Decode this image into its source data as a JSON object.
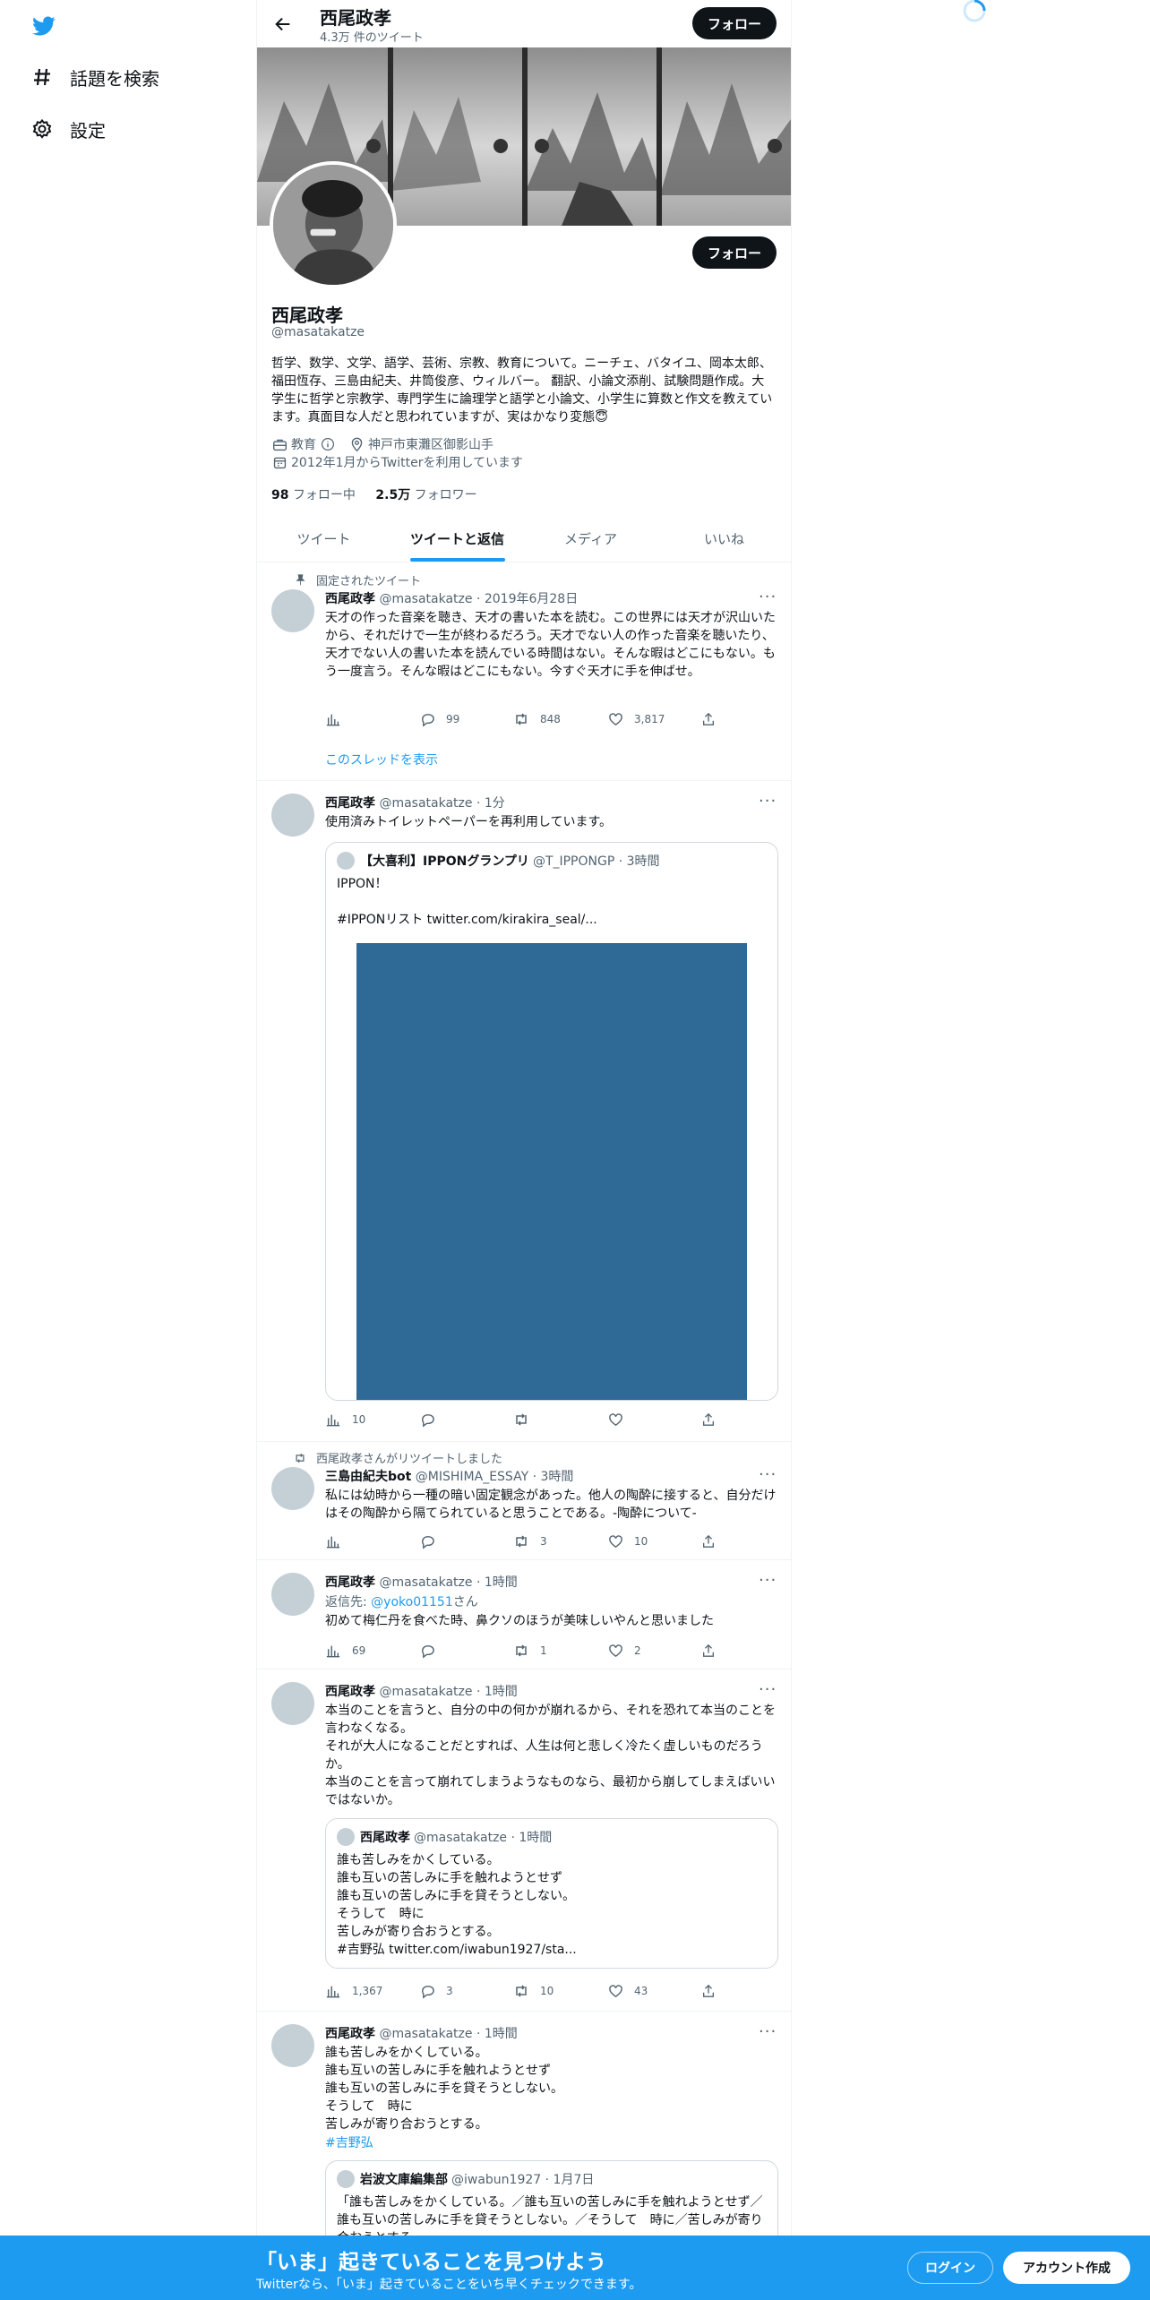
{
  "nav": {
    "items": [
      {
        "label": "話題を検索",
        "icon": "hash-icon"
      },
      {
        "label": "設定",
        "icon": "gear-icon"
      }
    ]
  },
  "header": {
    "name": "西尾政孝",
    "tweet_count": "4.3万 件のツイート",
    "follow_label": "フォロー"
  },
  "profile": {
    "name": "西尾政孝",
    "handle": "@masatakatze",
    "follow_label": "フォロー",
    "bio": "哲学、数学、文学、語学、芸術、宗教、教育について。ニーチェ、バタイユ、岡本太郎、福田恆存、三島由紀夫、井筒俊彦、ウィルバー。 翻訳、小論文添削、試験問題作成。大学生に哲学と宗教学、専門学生に論理学と語学と小論文、小学生に算数と作文を教えています。真面目な人だと思われていますが、実はかなり変態😇",
    "category": "教育",
    "location": "神戸市東灘区御影山手",
    "joined": "2012年1月からTwitterを利用しています",
    "following_count": "98",
    "following_label": "フォロー中",
    "followers_count": "2.5万",
    "followers_label": "フォロワー"
  },
  "tabs": [
    "ツイート",
    "ツイートと返信",
    "メディア",
    "いいね"
  ],
  "active_tab": 1,
  "tweets": [
    {
      "social": "固定されたツイート",
      "name": "西尾政孝",
      "meta": "@masatakatze · 2019年6月28日",
      "text": "天才の作った音楽を聴き、天才の書いた本を読む。この世界には天才が沢山いたから、それだけで一生が終わるだろう。天才でない人の作った音楽を聴いたり、天才でない人の書いた本を読んでいる時間はない。そんな暇はどこにもない。もう一度言う。そんな暇はどこにもない。今すぐ天才に手を伸ばせ。",
      "views": "",
      "replies": "99",
      "retweets": "848",
      "likes": "3,817",
      "thread_link": "このスレッドを表示"
    },
    {
      "name": "西尾政孝",
      "meta": "@masatakatze · 1分",
      "text": "使用済みトイレットペーパーを再利用しています。",
      "quote": {
        "name": "【大喜利】IPPONグランプリ",
        "meta": "@T_IPPONGP · 3時間",
        "text": "IPPON！\n\n#IPPONリスト  twitter.com/kirakira_seal/..."
      },
      "views": "10",
      "replies": "",
      "retweets": "",
      "likes": ""
    },
    {
      "social": "西尾政孝さんがリツイートしました",
      "name": "三島由紀夫bot",
      "meta": "@MISHIMA_ESSAY · 3時間",
      "text": "私には幼時から一種の暗い固定観念があった。他人の陶酔に接すると、自分だけはその陶酔から隔てられていると思うことである。-陶酔について-",
      "views": "",
      "replies": "",
      "retweets": "3",
      "likes": "10"
    },
    {
      "name": "西尾政孝",
      "meta": "@masatakatze · 1時間",
      "reply_prefix": "返信先: ",
      "reply_to": "@yoko01151",
      "reply_suffix": "さん",
      "text": "初めて梅仁丹を食べた時、鼻クソのほうが美味しいやんと思いました",
      "views": "69",
      "replies": "",
      "retweets": "1",
      "likes": "2"
    },
    {
      "name": "西尾政孝",
      "meta": "@masatakatze · 1時間",
      "text": "本当のことを言うと、自分の中の何かが崩れるから、それを恐れて本当のことを言わなくなる。\nそれが大人になることだとすれば、人生は何と悲しく冷たく虚しいものだろうか。\n本当のことを言って崩れてしまうようなものなら、最初から崩してしまえばいいではないか。",
      "quote": {
        "name": "西尾政孝",
        "meta": "@masatakatze · 1時間",
        "text": "誰も苦しみをかくしている。\n誰も互いの苦しみに手を触れようとせず\n誰も互いの苦しみに手を貸そうとしない。\nそうして　時に\n苦しみが寄り合おうとする。\n#吉野弘 twitter.com/iwabun1927/sta..."
      },
      "views": "1,367",
      "replies": "3",
      "retweets": "10",
      "likes": "43"
    },
    {
      "name": "西尾政孝",
      "meta": "@masatakatze · 1時間",
      "text": "誰も苦しみをかくしている。\n誰も互いの苦しみに手を触れようとせず\n誰も互いの苦しみに手を貸そうとしない。\nそうして　時に\n苦しみが寄り合おうとする。",
      "hashtag": "#吉野弘",
      "quote": {
        "name": "岩波文庫編集部",
        "meta": "@iwabun1927 · 1月7日",
        "text": "「誰も苦しみをかくしている。／誰も互いの苦しみに手を触れようとせず／誰も互いの苦しみに手を貸そうとしない。／そうして　時に／苦しみが寄り合おうとする。"
      }
    }
  ],
  "bottom_bar": {
    "title": "「いま」起きていることを見つけよう",
    "subtitle": "Twitterなら、「いま」起きていることをいち早くチェックできます。",
    "login_label": "ログイン",
    "signup_label": "アカウント作成"
  },
  "colors": {
    "accent": "#1d9bf0",
    "text": "#0f1419",
    "muted": "#536471",
    "media": "#2e6a95"
  }
}
